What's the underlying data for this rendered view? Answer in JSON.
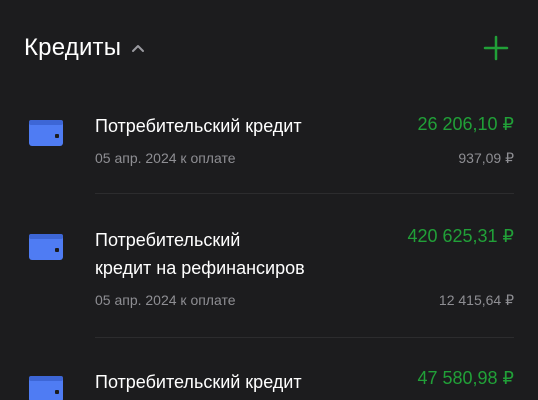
{
  "header": {
    "title": "Кредиты",
    "chevron_icon": "chevron-up-icon",
    "add_icon": "plus-icon"
  },
  "colors": {
    "background": "#1c1c1e",
    "accent": "#21a038",
    "secondary_text": "#8e8e93",
    "wallet_icon": "#4f7cf3"
  },
  "loans": [
    {
      "icon": "wallet-icon",
      "name_line1": "Потребительский кредит",
      "name_line2": "",
      "amount": "26 206,10 ₽",
      "due": "05 апр. 2024 к оплате",
      "payment": "937,09 ₽"
    },
    {
      "icon": "wallet-icon",
      "name_line1": "Потребительский",
      "name_line2": "кредит на рефинансиров",
      "amount": "420 625,31 ₽",
      "due": "05 апр. 2024 к оплате",
      "payment": "12 415,64 ₽"
    },
    {
      "icon": "wallet-icon",
      "name_line1": "Потребительский кредит",
      "name_line2": "",
      "amount": "47 580,98 ₽",
      "due": "",
      "payment": ""
    }
  ]
}
